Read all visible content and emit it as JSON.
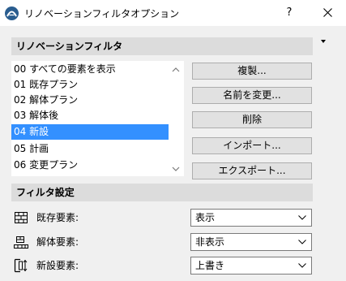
{
  "window": {
    "title": "リノベーションフィルタオプション",
    "help_label": "?"
  },
  "filters_section": {
    "header": "リノベーションフィルタ",
    "items": [
      {
        "label": "00 すべての要素を表示",
        "selected": false
      },
      {
        "label": "01 既存プラン",
        "selected": false
      },
      {
        "label": "02 解体プラン",
        "selected": false
      },
      {
        "label": "03 解体後",
        "selected": false
      },
      {
        "label": "04 新設",
        "selected": true
      },
      {
        "label": "05 計画",
        "selected": false
      },
      {
        "label": "06 変更プラン",
        "selected": false
      }
    ]
  },
  "buttons": {
    "duplicate": "複製...",
    "rename": "名前を変更...",
    "delete": "削除",
    "import": "インポート...",
    "export": "エクスポート..."
  },
  "settings_section": {
    "header": "フィルタ設定",
    "rows": [
      {
        "label": "既存要素:",
        "value": "表示",
        "icon": "existing-elements-icon"
      },
      {
        "label": "解体要素:",
        "value": "非表示",
        "icon": "demolished-elements-icon"
      },
      {
        "label": "新設要素:",
        "value": "上書き",
        "icon": "new-elements-icon"
      }
    ]
  },
  "colors": {
    "selection": "#3390ff",
    "section_header_bg": "#dcdcdc",
    "dialog_bg": "#f0f0f0",
    "button_bg": "#e1e1e1"
  }
}
